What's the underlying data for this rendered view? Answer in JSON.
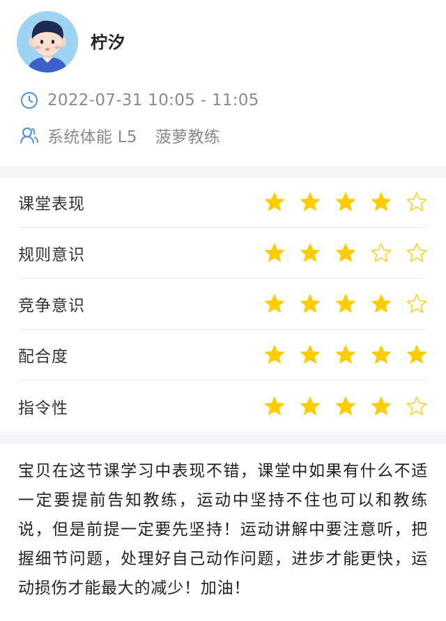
{
  "user": {
    "name": "柠汐"
  },
  "session": {
    "time": "2022-07-31 10:05 - 11:05",
    "course": "系统体能 L5",
    "coach": "菠萝教练",
    "time_icon": "clock-icon",
    "course_icon": "coach-user-icon"
  },
  "colors": {
    "star_fill": "#FFCC00",
    "icon_blue": "#4a90d9",
    "divider": "#f4f5f9"
  },
  "ratings": [
    {
      "label": "课堂表现",
      "value": 4,
      "max": 5
    },
    {
      "label": "规则意识",
      "value": 3,
      "max": 5
    },
    {
      "label": "竞争意识",
      "value": 4,
      "max": 5
    },
    {
      "label": "配合度",
      "value": 5,
      "max": 5
    },
    {
      "label": "指令性",
      "value": 4,
      "max": 5
    }
  ],
  "comment": "宝贝在这节课学习中表现不错，课堂中如果有什么不适一定要提前告知教练，运动中坚持不住也可以和教练说，但是前提一定要先坚持！运动讲解中要注意听，把握细节问题，处理好自己动作问题，进步才能更快，运动损伤才能最大的减少！加油！"
}
